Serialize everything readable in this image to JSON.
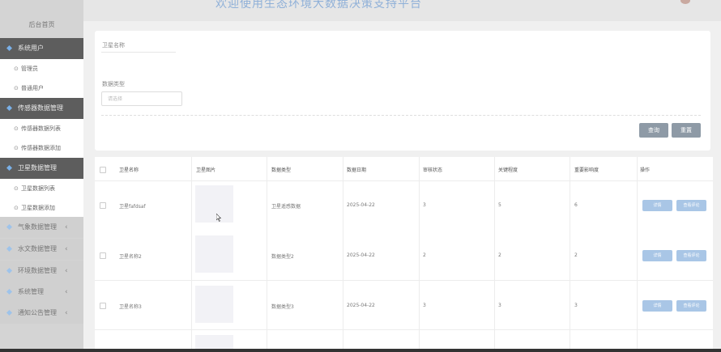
{
  "header": {
    "title": "欢迎使用生态环境大数据决策支持平台"
  },
  "sidebar": {
    "home": "后台首页",
    "groups": [
      {
        "label": "系统用户",
        "items": [
          "管理员",
          "普通用户"
        ]
      },
      {
        "label": "传感器数据管理",
        "items": [
          "传感器数据列表",
          "传感器数据添加"
        ]
      },
      {
        "label": "卫星数据管理",
        "items": [
          "卫星数据列表",
          "卫星数据添加"
        ]
      }
    ],
    "collapsed": [
      "气象数据管理",
      "水文数据管理",
      "环境数据管理",
      "系统管理",
      "通知公告管理"
    ]
  },
  "filter": {
    "name_label": "卫星名称",
    "name_value": "",
    "type_label": "数据类型",
    "type_placeholder": "请选择",
    "query_button": "查询",
    "reset_button": "重置"
  },
  "table": {
    "columns": [
      "卫星名称",
      "卫星图片",
      "数据类型",
      "数据日期",
      "审核状态",
      "关键程度",
      "重要影响度",
      "操作"
    ],
    "rows": [
      {
        "name": "卫星fafdsaf",
        "type": "卫星遥感数据",
        "date": "2025-04-22",
        "c1": "3",
        "c2": "5",
        "c3": "6"
      },
      {
        "name": "卫星名称2",
        "type": "数据类型2",
        "date": "2025-04-22",
        "c1": "2",
        "c2": "2",
        "c3": "2"
      },
      {
        "name": "卫星名称3",
        "type": "数据类型3",
        "date": "2025-04-22",
        "c1": "3",
        "c2": "3",
        "c3": "3"
      }
    ],
    "detail_button": "详情",
    "review_button": "查看评论"
  },
  "colors": {
    "sidebar_active": "#5d5d5d",
    "accent_icon": "#7ab0e8",
    "action_button": "#a9c6e6",
    "filter_button": "#8e9aa6"
  }
}
